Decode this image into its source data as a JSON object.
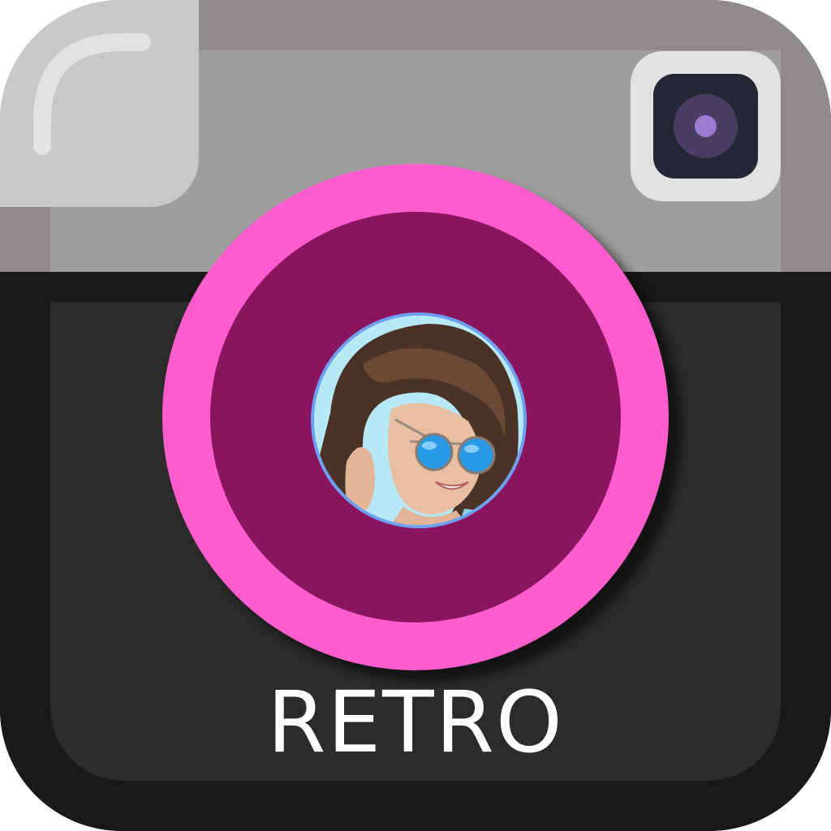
{
  "app": {
    "label": "RETRO"
  },
  "icons": {
    "flash": "flash-highlight-icon",
    "viewfinder": "viewfinder-icon",
    "lens": "camera-lens-icon"
  },
  "colors": {
    "body_top": "#8f8b8a",
    "body_bottom": "#191919",
    "lens_outer": "#ff5ccd",
    "lens_inner": "#88155e",
    "photo_border": "#6f9ff0",
    "viewfinder_dot": "#9a7bd0",
    "label": "#ffffff"
  }
}
